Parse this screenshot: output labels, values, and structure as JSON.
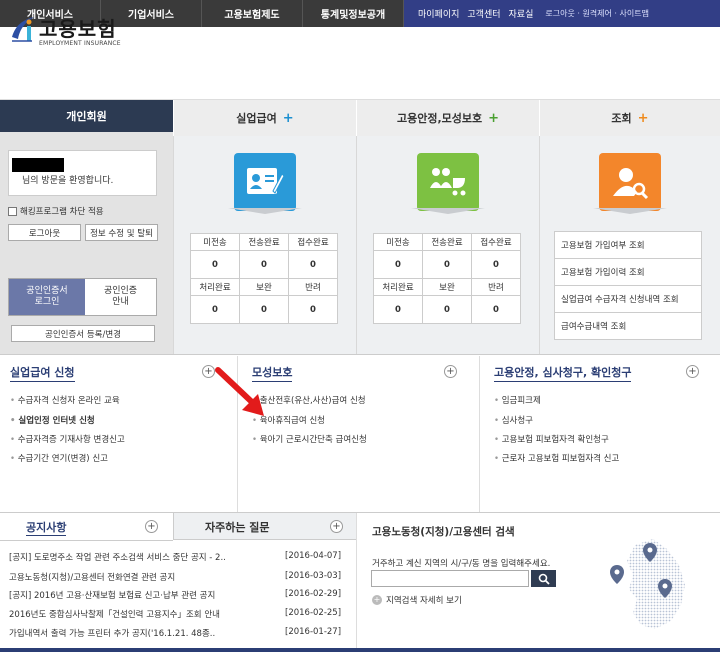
{
  "topnav": {
    "items": [
      "개인서비스",
      "기업서비스",
      "고용보험제도",
      "통계및정보공개"
    ],
    "right": [
      "마이페이지",
      "고객센터",
      "자료실"
    ],
    "right_small": "로그아웃 · 원격제어 · 사이트맵"
  },
  "logo": {
    "kr": "고용보험",
    "en": "EMPLOYMENT INSURANCE"
  },
  "left": {
    "tab": "개인회원",
    "welcome": "님의 방문을 환영합니다.",
    "hacking": "해킹프로그램 차단 적용",
    "logout": "로그아웃",
    "edit_info": "정보 수정 및 탈퇴",
    "cert_login": [
      "공인인증서",
      "로그인"
    ],
    "cert_guide": [
      "공인인증",
      "안내"
    ],
    "cert_register": "공인인증서 등록/변경"
  },
  "services": {
    "tabs": [
      "실업급여",
      "고용안정,모성보호",
      "조회"
    ],
    "table_headers1": [
      "미전송",
      "전송완료",
      "접수완료"
    ],
    "table_headers2": [
      "처리완료",
      "보완",
      "반려"
    ],
    "col1_values1": [
      "0",
      "0",
      "0"
    ],
    "col1_values2": [
      "0",
      "0",
      "0"
    ],
    "col2_values1": [
      "0",
      "0",
      "0"
    ],
    "col2_values2": [
      "0",
      "0",
      "0"
    ],
    "lookups": [
      "고용보험 가입여부 조회",
      "고용보험 가입이력 조회",
      "실업급여 수급자격 신청내역 조회",
      "급여수급내역 조회"
    ]
  },
  "sections": {
    "s1": {
      "title": "실업급여 신청",
      "items": [
        "수급자격 신청자 온라인 교육",
        "실업인정 인터넷 신청",
        "수급자격증 기재사항 변경신고",
        "수급기간 연기(변경) 신고"
      ]
    },
    "s2": {
      "title": "모성보호",
      "items": [
        "출산전후(유산,사산)급여 신청",
        "육아휴직급여 신청",
        "육아기 근로시간단축 급여신청"
      ]
    },
    "s3": {
      "title": "고용안정, 심사청구, 확인청구",
      "items": [
        "임금피크제",
        "심사청구",
        "고용보험 피보험자격 확인청구",
        "근로자 고용보험 피보험자격 신고"
      ]
    }
  },
  "notice": {
    "tab1": "공지사항",
    "tab2": "자주하는 질문",
    "items": [
      {
        "text": "[공지] 도로명주소 작업 관련 주소검색 서비스 중단 공지 - 2..",
        "date": "[2016-04-07]"
      },
      {
        "text": "고용노동청(지청)/고용센터 전화연결 관련 공지",
        "date": "[2016-03-03]"
      },
      {
        "text": "[공지] 2016년 고용·산재보험 보험료 신고·납부 관련 공지",
        "date": "[2016-02-29]"
      },
      {
        "text": "2016년도 중합심사낙찰제「건설인력 고용지수」조회 안내",
        "date": "[2016-02-25]"
      },
      {
        "text": "가입내역서 출력 가능 프린터 추가 공지('16.1.21. 48종..",
        "date": "[2016-01-27]"
      }
    ]
  },
  "search": {
    "title": "고용노동청(지청)/고용센터 검색",
    "desc": "거주하고 계신 지역의 시/구/동 명을 입력해주세요.",
    "placeholder": "",
    "detail": "지역검색 자세히 보기"
  },
  "colors": {
    "nav": "#3a3a3a",
    "nav_right": "#323e86",
    "blue_icon": "#2a9ad8",
    "green_icon": "#7dc142",
    "orange_icon": "#f3862b",
    "arrow": "#e21b1b"
  }
}
